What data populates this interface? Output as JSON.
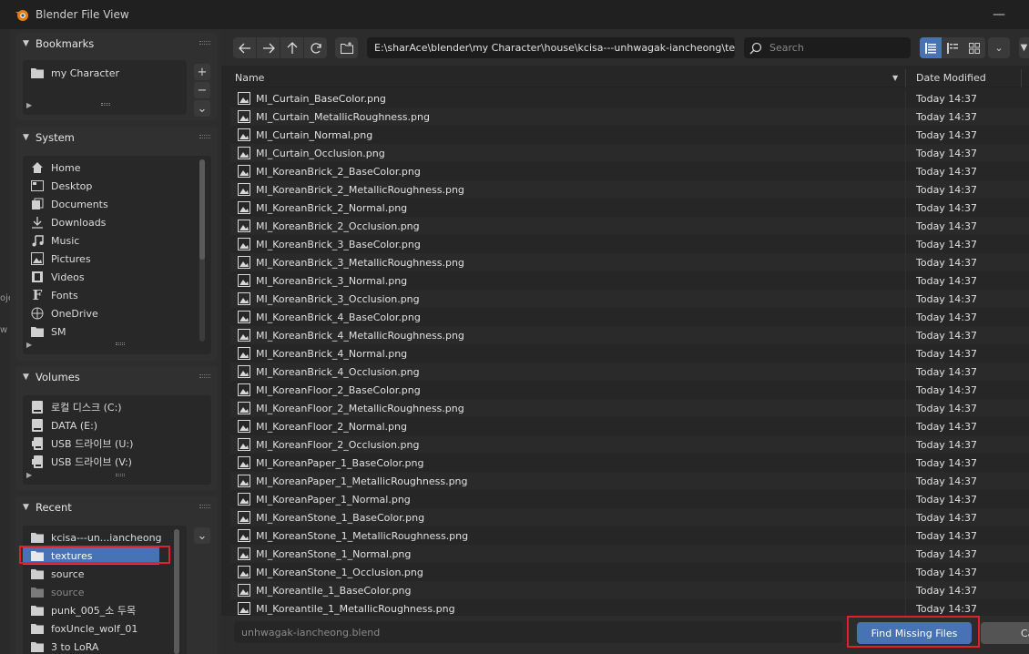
{
  "window": {
    "title": "Blender File View",
    "minimize_glyph": "—"
  },
  "left_edge": {
    "labels": [
      "oje",
      "w"
    ]
  },
  "bookmarks": {
    "header": "Bookmarks",
    "items": [
      {
        "label": "my Character",
        "icon": "folder-icon"
      }
    ],
    "buttons": [
      "+",
      "−",
      "⌄"
    ]
  },
  "system": {
    "header": "System",
    "items": [
      {
        "label": "Home",
        "icon": "home-icon"
      },
      {
        "label": "Desktop",
        "icon": "desktop-icon"
      },
      {
        "label": "Documents",
        "icon": "documents-icon"
      },
      {
        "label": "Downloads",
        "icon": "download-icon"
      },
      {
        "label": "Music",
        "icon": "music-icon"
      },
      {
        "label": "Pictures",
        "icon": "picture-icon"
      },
      {
        "label": "Videos",
        "icon": "video-icon"
      },
      {
        "label": "Fonts",
        "icon": "font-icon"
      },
      {
        "label": "OneDrive",
        "icon": "globe-icon"
      },
      {
        "label": "SM",
        "icon": "folder-icon"
      }
    ]
  },
  "volumes": {
    "header": "Volumes",
    "items": [
      {
        "label": "로컬 디스크 (C:)",
        "icon": "disk-icon"
      },
      {
        "label": "DATA (E:)",
        "icon": "disk-icon"
      },
      {
        "label": "USB 드라이브 (U:)",
        "icon": "usb-icon"
      },
      {
        "label": "USB 드라이브 (V:)",
        "icon": "usb-icon"
      }
    ]
  },
  "recent": {
    "header": "Recent",
    "items": [
      {
        "label": "kcisa---un...iancheong",
        "state": "normal"
      },
      {
        "label": "textures",
        "state": "selected"
      },
      {
        "label": "source",
        "state": "normal"
      },
      {
        "label": "source",
        "state": "dim"
      },
      {
        "label": "punk_005_소 두목",
        "state": "normal"
      },
      {
        "label": "foxUncle_wolf_01",
        "state": "normal"
      },
      {
        "label": "3 to LoRA",
        "state": "normal"
      }
    ]
  },
  "toolbar": {
    "path": "E:\\sharAce\\blender\\my Character\\house\\kcisa---unhwagak-iancheong\\te...",
    "search_placeholder": "Search"
  },
  "columns": {
    "name": "Name",
    "date": "Date Modified"
  },
  "files": [
    {
      "name": "MI_Curtain_BaseColor.png",
      "date": "Today 14:37"
    },
    {
      "name": "MI_Curtain_MetallicRoughness.png",
      "date": "Today 14:37"
    },
    {
      "name": "MI_Curtain_Normal.png",
      "date": "Today 14:37"
    },
    {
      "name": "MI_Curtain_Occlusion.png",
      "date": "Today 14:37"
    },
    {
      "name": "MI_KoreanBrick_2_BaseColor.png",
      "date": "Today 14:37"
    },
    {
      "name": "MI_KoreanBrick_2_MetallicRoughness.png",
      "date": "Today 14:37"
    },
    {
      "name": "MI_KoreanBrick_2_Normal.png",
      "date": "Today 14:37"
    },
    {
      "name": "MI_KoreanBrick_2_Occlusion.png",
      "date": "Today 14:37"
    },
    {
      "name": "MI_KoreanBrick_3_BaseColor.png",
      "date": "Today 14:37"
    },
    {
      "name": "MI_KoreanBrick_3_MetallicRoughness.png",
      "date": "Today 14:37"
    },
    {
      "name": "MI_KoreanBrick_3_Normal.png",
      "date": "Today 14:37"
    },
    {
      "name": "MI_KoreanBrick_3_Occlusion.png",
      "date": "Today 14:37"
    },
    {
      "name": "MI_KoreanBrick_4_BaseColor.png",
      "date": "Today 14:37"
    },
    {
      "name": "MI_KoreanBrick_4_MetallicRoughness.png",
      "date": "Today 14:37"
    },
    {
      "name": "MI_KoreanBrick_4_Normal.png",
      "date": "Today 14:37"
    },
    {
      "name": "MI_KoreanBrick_4_Occlusion.png",
      "date": "Today 14:37"
    },
    {
      "name": "MI_KoreanFloor_2_BaseColor.png",
      "date": "Today 14:37"
    },
    {
      "name": "MI_KoreanFloor_2_MetallicRoughness.png",
      "date": "Today 14:37"
    },
    {
      "name": "MI_KoreanFloor_2_Normal.png",
      "date": "Today 14:37"
    },
    {
      "name": "MI_KoreanFloor_2_Occlusion.png",
      "date": "Today 14:37"
    },
    {
      "name": "MI_KoreanPaper_1_BaseColor.png",
      "date": "Today 14:37"
    },
    {
      "name": "MI_KoreanPaper_1_MetallicRoughness.png",
      "date": "Today 14:37"
    },
    {
      "name": "MI_KoreanPaper_1_Normal.png",
      "date": "Today 14:37"
    },
    {
      "name": "MI_KoreanStone_1_BaseColor.png",
      "date": "Today 14:37"
    },
    {
      "name": "MI_KoreanStone_1_MetallicRoughness.png",
      "date": "Today 14:37"
    },
    {
      "name": "MI_KoreanStone_1_Normal.png",
      "date": "Today 14:37"
    },
    {
      "name": "MI_KoreanStone_1_Occlusion.png",
      "date": "Today 14:37"
    },
    {
      "name": "MI_Koreantile_1_BaseColor.png",
      "date": "Today 14:37"
    },
    {
      "name": "MI_Koreantile_1_MetallicRoughness.png",
      "date": "Today 14:37"
    }
  ],
  "bottom": {
    "filename": "unhwagak-iancheong.blend",
    "primary_label": "Find Missing Files",
    "cancel_label": "Cancel"
  },
  "colors": {
    "accent": "#4772b3",
    "highlight_box": "#e0202a"
  }
}
